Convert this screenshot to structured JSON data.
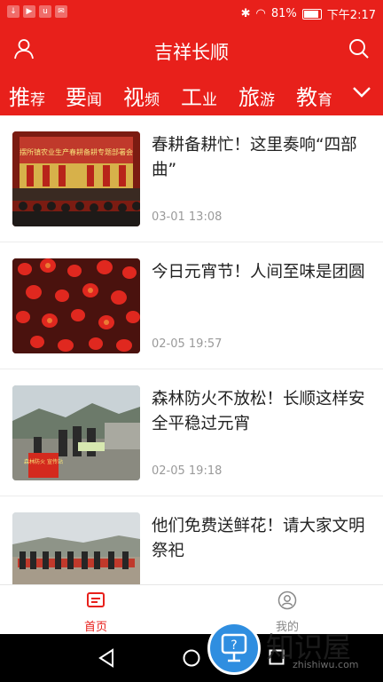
{
  "status_bar": {
    "battery": "81%",
    "time": "下午2:17"
  },
  "header": {
    "title": "吉祥长顺",
    "user_icon": "user-icon",
    "search_icon": "search-icon"
  },
  "tabs": [
    {
      "big": "推",
      "small": "荐"
    },
    {
      "big": "要",
      "small": "闻"
    },
    {
      "big": "视",
      "small": "频"
    },
    {
      "big": "工",
      "small": "业"
    },
    {
      "big": "旅",
      "small": "游"
    },
    {
      "big": "教",
      "small": "育"
    }
  ],
  "active_tab": "要闻",
  "news": [
    {
      "title": "春耕备耕忙！这里奏响“四部曲”",
      "date": "03-01 13:08",
      "thumb_text": "摆所镇农业生产春耕备耕专题部署会"
    },
    {
      "title": "今日元宵节！人间至味是团圆",
      "date": "02-05 19:57"
    },
    {
      "title": "森林防火不放松！长顺这样安全平稳过元宵",
      "date": "02-05 19:18",
      "thumb_text": "森林防火 宣传站"
    },
    {
      "title": "他们免费送鲜花！请大家文明祭祀",
      "date": ""
    }
  ],
  "bottom_nav": [
    {
      "label": "首页",
      "icon": "home-icon",
      "active": true
    },
    {
      "label": "我的",
      "icon": "profile-icon",
      "active": false
    }
  ],
  "watermark": {
    "text": "知识屋",
    "sub": "zhishiwu.com"
  },
  "colors": {
    "brand": "#e8201b",
    "date": "#9a9a9a"
  }
}
